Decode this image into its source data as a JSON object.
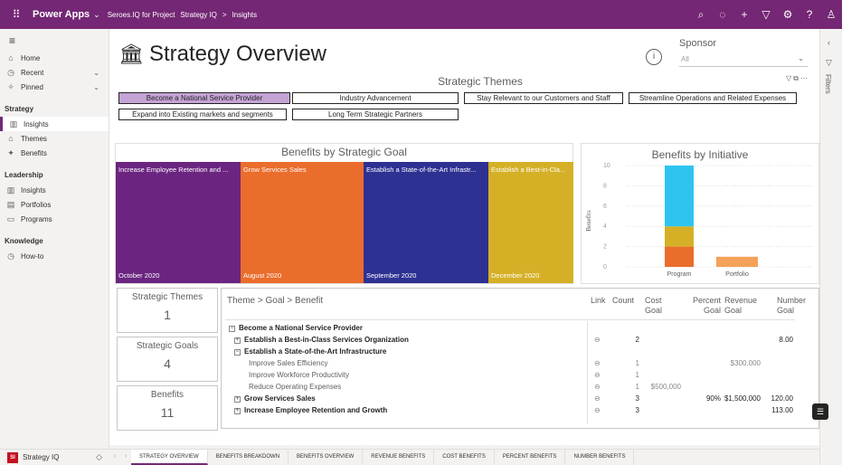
{
  "topbar": {
    "app_name": "Power Apps",
    "crumbs": [
      "Seroes.IQ for Project",
      "Strategy IQ",
      "Insights"
    ],
    "crumb_sep": ">",
    "icons": [
      "search-icon",
      "assistant-icon",
      "plus-icon",
      "filter-icon",
      "gear-icon",
      "help-icon",
      "person-icon"
    ]
  },
  "nav": {
    "items_top": [
      {
        "label": "Home",
        "icon": "home-icon"
      },
      {
        "label": "Recent",
        "icon": "clock-icon",
        "chevron": true
      },
      {
        "label": "Pinned",
        "icon": "pin-icon",
        "chevron": true
      }
    ],
    "sections": [
      {
        "title": "Strategy",
        "items": [
          {
            "label": "Insights",
            "icon": "chart-icon",
            "active": true
          },
          {
            "label": "Themes",
            "icon": "bank-icon"
          },
          {
            "label": "Benefits",
            "icon": "benefits-icon"
          }
        ]
      },
      {
        "title": "Leadership",
        "items": [
          {
            "label": "Insights",
            "icon": "chart-icon"
          },
          {
            "label": "Portfolios",
            "icon": "portfolio-icon"
          },
          {
            "label": "Programs",
            "icon": "program-icon"
          }
        ]
      },
      {
        "title": "Knowledge",
        "items": [
          {
            "label": "How-to",
            "icon": "clock-icon"
          }
        ]
      }
    ],
    "app_switcher": {
      "badge": "SI",
      "label": "Strategy IQ"
    }
  },
  "report": {
    "title": "Strategy Overview",
    "info_icon": "i",
    "sponsor": {
      "label": "Sponsor",
      "value": "All"
    },
    "strategic_themes": {
      "title": "Strategic Themes",
      "buttons": [
        "Become a National Service Provider",
        "Industry Advancement",
        "Stay Relevant to our Customers and Staff",
        "Streamline Operations and Related Expenses",
        "Expand into Existing markets and segments",
        "Long Term Strategic Partners"
      ],
      "selected_index": 0,
      "selected_color": "#c4a3d5"
    },
    "benefits_by_goal": {
      "title": "Benefits by Strategic Goal",
      "tiles": [
        {
          "label": "Increase Employee Retention and ...",
          "date": "October 2020",
          "color": "#6b2580"
        },
        {
          "label": "Grow Services Sales",
          "date": "August 2020",
          "color": "#ea6d2c"
        },
        {
          "label": "Establish a State-of-the-Art Infrastr...",
          "date": "September 2020",
          "color": "#2e3192"
        },
        {
          "label": "Establish a Best-in-Cla...",
          "date": "December 2020",
          "color": "#d5b027"
        }
      ]
    },
    "kpis": [
      {
        "label": "Strategic Themes",
        "value": "1"
      },
      {
        "label": "Strategic Goals",
        "value": "4"
      },
      {
        "label": "Benefits",
        "value": "11"
      }
    ],
    "matrix": {
      "headers": {
        "path": "Theme > Goal > Benefit",
        "link": "Link",
        "count": "Count",
        "cost": "Cost Goal",
        "percent": "Percent Goal",
        "revenue": "Revenue Goal",
        "number": "Number Goal"
      },
      "rows": [
        {
          "label": "Become a National Service Provider",
          "level": 0,
          "toggle": "−",
          "link": "",
          "count": "",
          "cost": "",
          "percent": "",
          "revenue": "",
          "number": ""
        },
        {
          "label": "Establish a Best-in-Class Services Organization",
          "level": 1,
          "toggle": "+",
          "link": "⊖",
          "count": "2",
          "cost": "",
          "percent": "",
          "revenue": "",
          "number": "8.00"
        },
        {
          "label": "Establish a State-of-the-Art Infrastructure",
          "level": 1,
          "toggle": "−",
          "link": "",
          "count": "",
          "cost": "",
          "percent": "",
          "revenue": "",
          "number": ""
        },
        {
          "label": "Improve Sales Efficiency",
          "level": 2,
          "toggle": "",
          "link": "⊖",
          "count": "1",
          "cost": "",
          "percent": "",
          "revenue": "$300,000",
          "number": ""
        },
        {
          "label": "Improve Workforce Productivity",
          "level": 2,
          "toggle": "",
          "link": "⊖",
          "count": "1",
          "cost": "",
          "percent": "",
          "revenue": "",
          "number": ""
        },
        {
          "label": "Reduce Operating Expenses",
          "level": 2,
          "toggle": "",
          "link": "⊖",
          "count": "1",
          "cost": "$500,000",
          "percent": "",
          "revenue": "",
          "number": ""
        },
        {
          "label": "Grow Services Sales",
          "level": 1,
          "toggle": "+",
          "link": "⊖",
          "count": "3",
          "cost": "",
          "percent": "90%",
          "revenue": "$1,500,000",
          "number": "120.00"
        },
        {
          "label": "Increase Employee Retention and Growth",
          "level": 1,
          "toggle": "+",
          "link": "⊖",
          "count": "3",
          "cost": "",
          "percent": "",
          "revenue": "",
          "number": "113.00"
        }
      ]
    }
  },
  "chart_data": {
    "type": "bar",
    "title": "Benefits by Initiative",
    "ylabel": "Benefits",
    "xlabel": "",
    "categories": [
      "Program",
      "Portfolio"
    ],
    "ylim": [
      0,
      10
    ],
    "yticks": [
      0,
      2,
      4,
      6,
      8,
      10
    ],
    "stacked": true,
    "series": [
      {
        "color": "#ea6d2c",
        "values": [
          2,
          0
        ]
      },
      {
        "color": "#d5b027",
        "values": [
          2,
          0
        ]
      },
      {
        "color": "#2dc5f0",
        "values": [
          6,
          0
        ]
      },
      {
        "color": "#f4a259",
        "values": [
          0,
          1
        ]
      }
    ],
    "grid": true
  },
  "tabs": [
    "STRATEGY OVERVIEW",
    "BENEFITS BREAKDOWN",
    "BENEFITS OVERVIEW",
    "REVENUE BENEFITS",
    "COST BENEFITS",
    "PERCENT BENEFITS",
    "NUMBER BENEFITS"
  ],
  "active_tab": 0,
  "filters_label": "Filters"
}
